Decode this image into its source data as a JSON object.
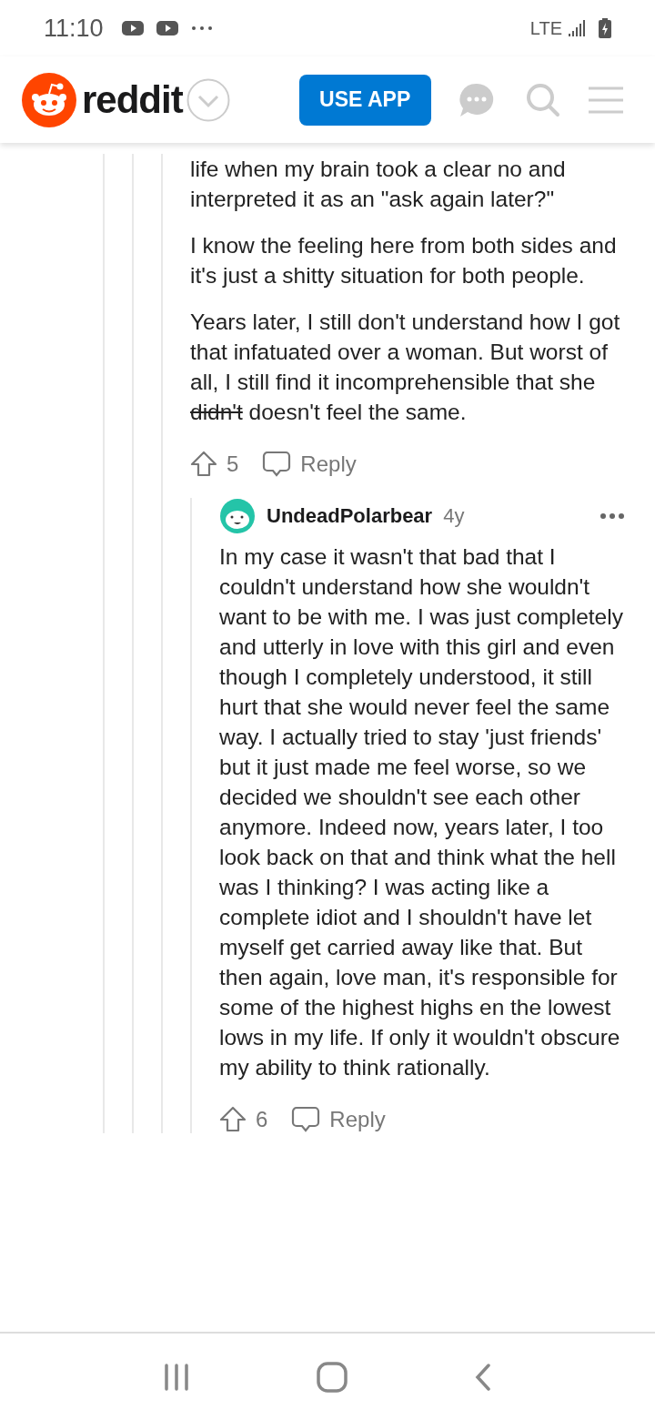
{
  "status_bar": {
    "time": "11:10",
    "network": "LTE"
  },
  "header": {
    "logo_text": "reddit",
    "button": "USE APP"
  },
  "comment": {
    "paragraphs": [
      [
        {
          "text": "life when my brain took a clear no and interpreted it as an \"ask again later?\"",
          "struck": false
        }
      ],
      [
        {
          "text": "I know the feeling here from both sides and it's just a shitty situation for both people.",
          "struck": false
        }
      ],
      [
        {
          "text": "Years later, I still don't understand how I got that infatuated over a woman. But worst of all, I still find it incomprehensible that she ",
          "struck": false
        },
        {
          "text": "didn't",
          "struck": true
        },
        {
          "text": " doesn't feel the same.",
          "struck": false
        }
      ]
    ],
    "votes": "5",
    "reply": "Reply"
  },
  "reply_comment": {
    "author": "UndeadPolarbear",
    "age": "4y",
    "paragraphs": [
      [
        {
          "text": "In my case it wasn't that bad that I couldn't understand how she wouldn't want to be with me. I was just completely and utterly in love with this girl and even though I completely understood, it still hurt that she would never feel the same way. I actually tried to stay 'just friends' but it just made me feel worse, so we decided we shouldn't see each other anymore. Indeed now, years later, I too look back on that and think what the hell was I thinking? I was acting like a complete idiot and I shouldn't have let myself get carried away like that. But then again, love man, it's responsible for some of the highest highs en the lowest lows in my life. If only it wouldn't obscure my ability to think rationally.",
          "struck": false
        }
      ]
    ],
    "votes": "6",
    "reply": "Reply"
  }
}
